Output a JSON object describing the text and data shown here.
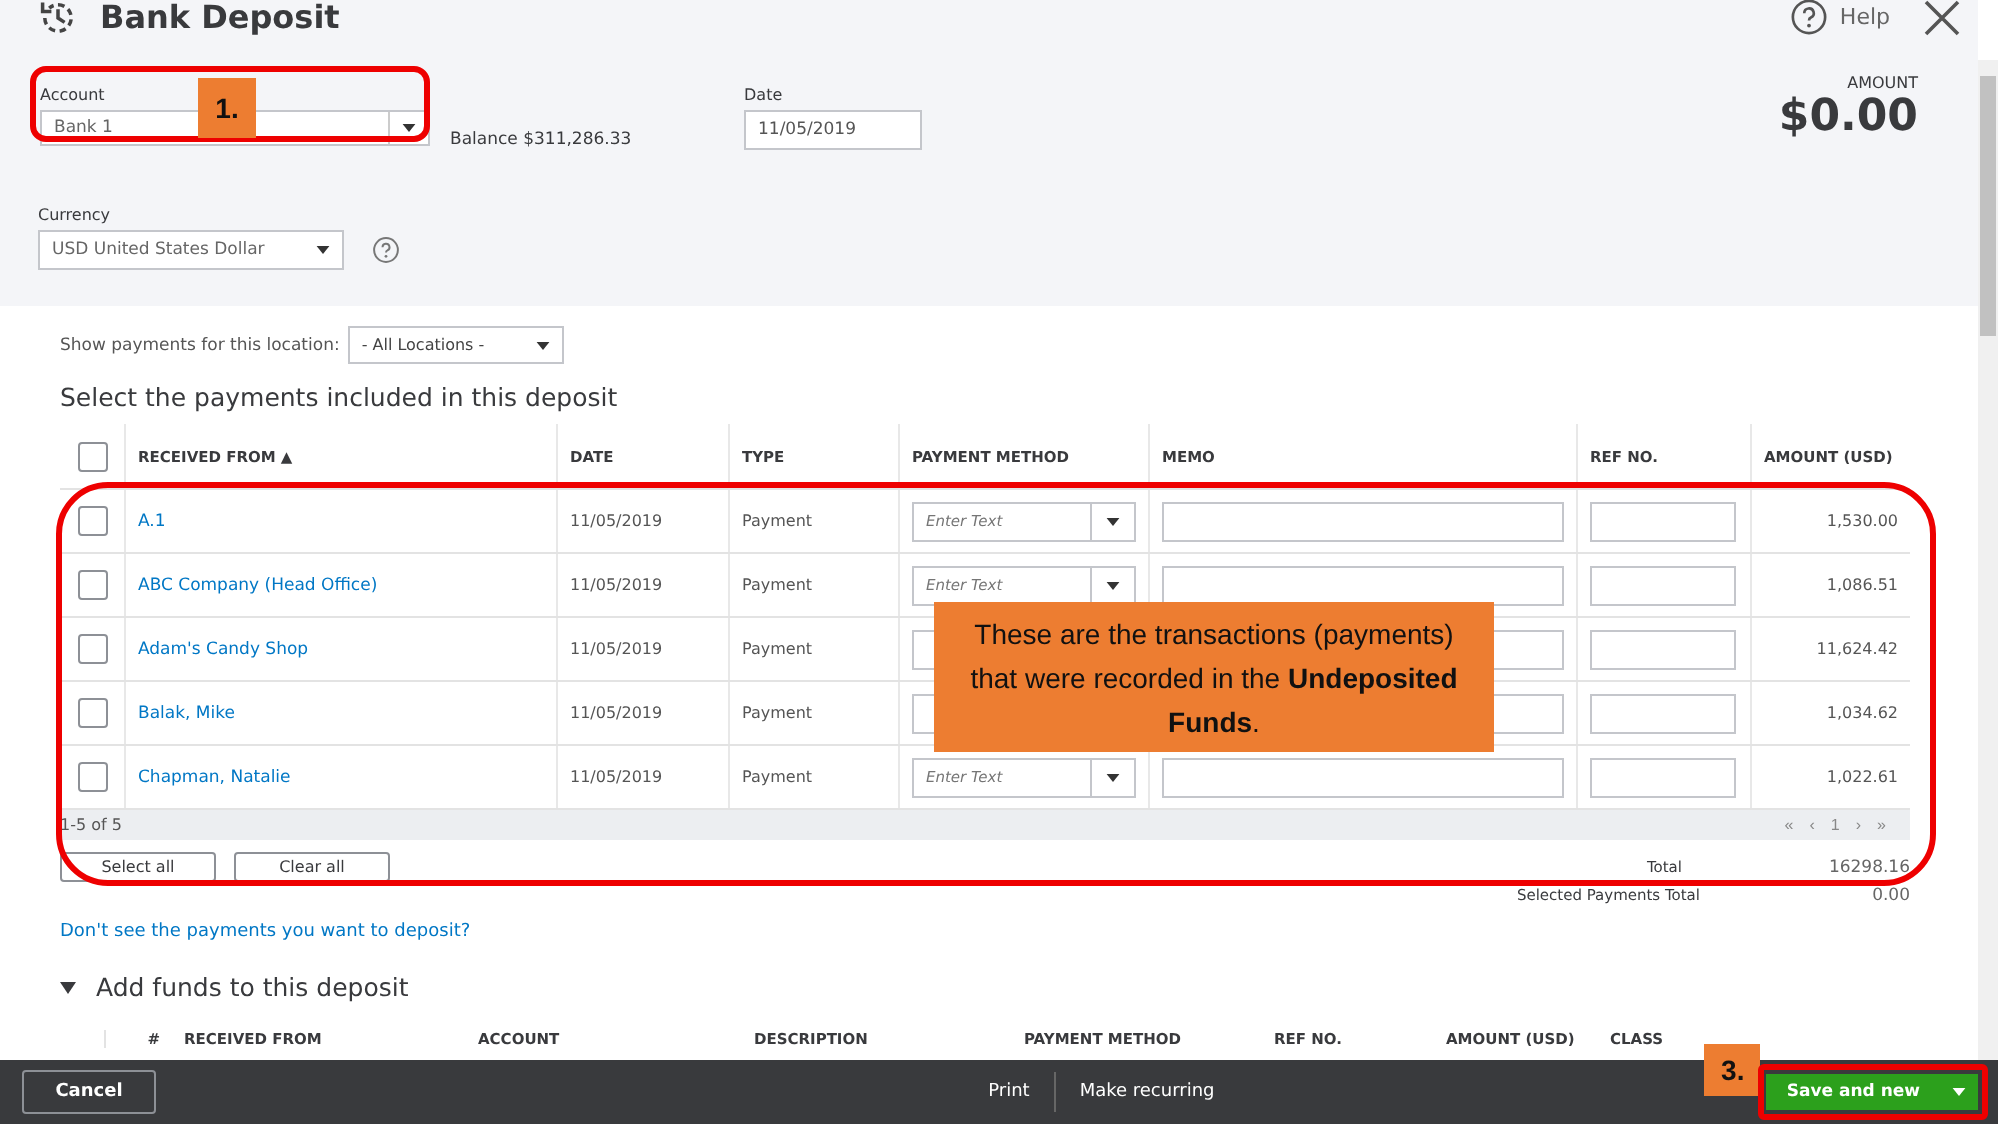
{
  "window": {
    "title": "Bank Deposit",
    "help": "Help"
  },
  "account": {
    "label": "Account",
    "value": "Bank 1",
    "balance": "Balance $311,286.33",
    "step_callout": "1."
  },
  "date": {
    "label": "Date",
    "value": "11/05/2019"
  },
  "amount": {
    "label": "AMOUNT",
    "value": "$0.00"
  },
  "currency": {
    "label": "Currency",
    "value": "USD United States Dollar"
  },
  "location": {
    "label": "Show payments for this location:",
    "value": "- All Locations -"
  },
  "payments": {
    "heading": "Select the payments included in this deposit",
    "all_checked": false,
    "columns": [
      "RECEIVED FROM ▲",
      "DATE",
      "TYPE",
      "PAYMENT METHOD",
      "MEMO",
      "REF NO.",
      "AMOUNT (USD)"
    ],
    "rows": [
      {
        "checked": false,
        "received_from": "A.1",
        "date": "11/05/2019",
        "type": "Payment",
        "method_placeholder": "Enter Text",
        "amount": "1,530.00"
      },
      {
        "checked": false,
        "received_from": "ABC Company (Head Office)",
        "date": "11/05/2019",
        "type": "Payment",
        "method_placeholder": "Enter Text",
        "amount": "1,086.51"
      },
      {
        "checked": false,
        "received_from": "Adam's Candy Shop",
        "date": "11/05/2019",
        "type": "Payment",
        "amount": "11,624.42"
      },
      {
        "checked": false,
        "received_from": "Balak, Mike",
        "date": "11/05/2019",
        "type": "Payment",
        "amount": "1,034.62"
      },
      {
        "checked": false,
        "received_from": "Chapman, Natalie",
        "date": "11/05/2019",
        "type": "Payment",
        "method_placeholder": "Enter Text",
        "amount": "1,022.61"
      }
    ],
    "range": "1-5 of 5",
    "pager": [
      "«",
      "‹",
      "1",
      "›",
      "»"
    ],
    "select_all": "Select all",
    "clear_all": "Clear all",
    "total_label": "Total",
    "total": "16298.16",
    "selected_total_label": "Selected Payments Total",
    "selected_total": "0.00",
    "missing_link": "Don't see the payments you want to deposit?",
    "note_callout": "These are the transactions (payments) that were recorded in the **Undeposited Funds**."
  },
  "add_funds": {
    "heading": "Add funds to this deposit",
    "expanded": true,
    "columns": [
      "#",
      "RECEIVED FROM",
      "ACCOUNT",
      "DESCRIPTION",
      "PAYMENT METHOD",
      "REF NO.",
      "AMOUNT (USD)",
      "CLASS"
    ]
  },
  "footer": {
    "cancel": "Cancel",
    "print": "Print",
    "recurring": "Make recurring",
    "save": "Save and new",
    "step_callout": "3."
  }
}
